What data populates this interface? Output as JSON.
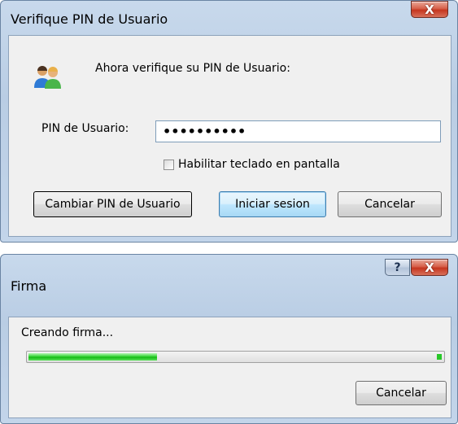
{
  "dialog_pin": {
    "title": "Verifique PIN de Usuario",
    "close_glyph": "X",
    "icon": "users-icon",
    "prompt": "Ahora verifique su PIN de Usuario:",
    "pin_label": "PIN de Usuario:",
    "pin_value": "••••••••••",
    "checkbox_label": "Habilitar teclado en pantalla",
    "checkbox_checked": false,
    "buttons": {
      "change_pin": "Cambiar PIN de Usuario",
      "login": "Iniciar sesion",
      "cancel": "Cancelar"
    }
  },
  "dialog_firma": {
    "title": "Firma",
    "help_glyph": "?",
    "close_glyph": "X",
    "status": "Creando firma...",
    "progress_fraction": 0.31,
    "cancel": "Cancelar"
  },
  "colors": {
    "progress_green": "#22c722",
    "close_red": "#c5361f",
    "window_frame": "#b9cde4",
    "client_bg": "#f0f0f0"
  }
}
